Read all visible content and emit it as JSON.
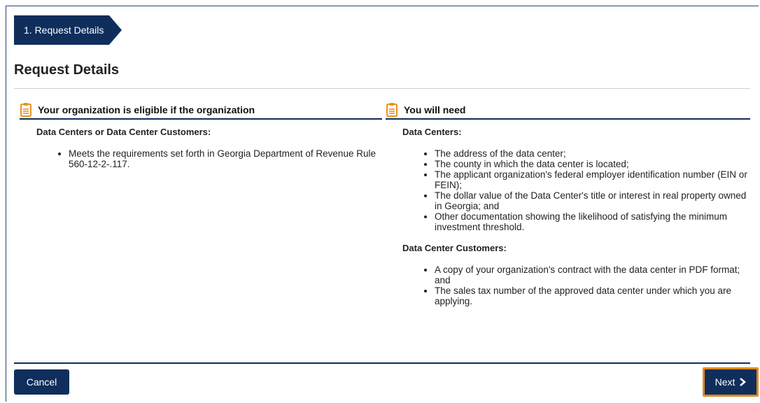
{
  "step_tab": {
    "label": "1. Request Details"
  },
  "page_title": "Request Details",
  "eligibility": {
    "heading": "Your organization is eligible if the organization",
    "icon": "clipboard-icon",
    "section_title": "Data Centers or Data Center Customers:",
    "items": [
      "Meets the requirements set forth in Georgia Department of Revenue Rule 560-12-2-.117."
    ]
  },
  "requirements": {
    "heading": "You will need",
    "icon": "clipboard-icon",
    "sections": [
      {
        "title": "Data Centers:",
        "items": [
          "The address of the data center;",
          "The county in which the data center is located;",
          "The applicant organization's federal employer identification number (EIN or FEIN);",
          "The dollar value of the Data Center's title or interest in real property owned in Georgia; and",
          "Other documentation showing the likelihood of satisfying the minimum investment threshold."
        ]
      },
      {
        "title": "Data Center Customers:",
        "items": [
          "A copy of your organization's contract with the data center in PDF format; and",
          "The sales tax number of the approved data center under which you are applying."
        ]
      }
    ]
  },
  "footer": {
    "cancel_label": "Cancel",
    "next_label": "Next"
  },
  "colors": {
    "navy": "#0f2e5c",
    "accent_orange": "#e08a1e",
    "icon_orange": "#e8931f"
  }
}
